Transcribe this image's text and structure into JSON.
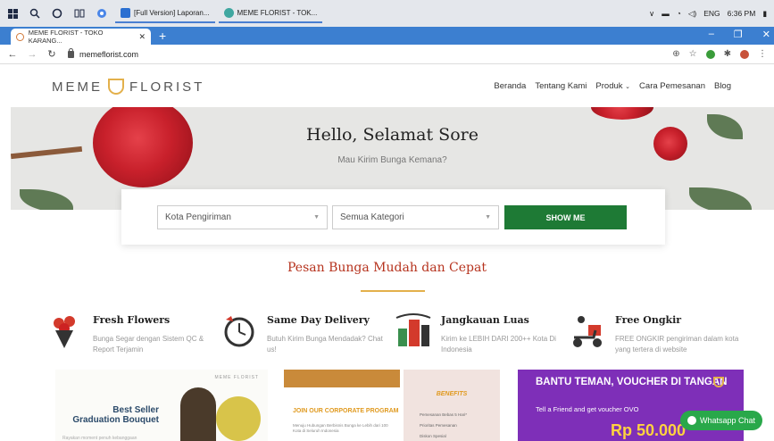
{
  "taskbar": {
    "apps": [
      {
        "label": "[Full Version] Laporan..."
      },
      {
        "label": "MEME FLORIST - TOK..."
      }
    ],
    "tray": {
      "language": "ENG",
      "time": "6:36 PM"
    }
  },
  "browser": {
    "tab_title": "MEME FLORIST - TOKO KARANG...",
    "tab_close": "✕",
    "new_tab": "+",
    "url": "memeflorist.com"
  },
  "site": {
    "logo_left": "MEME",
    "logo_right": "FLORIST",
    "nav": [
      "Beranda",
      "Tentang Kami",
      "Produk",
      "Cara Pemesanan",
      "Blog"
    ],
    "hero_title": "Hello, Selamat Sore",
    "hero_subtitle": "Mau Kirim Bunga Kemana?",
    "search": {
      "city_select": "Kota Pengiriman",
      "category_select": "Semua Kategori",
      "button": "SHOW ME"
    },
    "section_title": "Pesan Bunga Mudah dan Cepat",
    "features": [
      {
        "title": "Fresh Flowers",
        "desc": "Bunga Segar dengan Sistem QC & Report Terjamin"
      },
      {
        "title": "Same Day Delivery",
        "desc": "Butuh Kirim Bunga Mendadak? Chat us!"
      },
      {
        "title": "Jangkauan Luas",
        "desc": "Kirim ke LEBIH DARI 200++ Kota Di Indonesia"
      },
      {
        "title": "Free Ongkir",
        "desc": "FREE ONGKIR pengiriman dalam kota yang tertera di website"
      }
    ],
    "promos": {
      "card1": {
        "brand": "MEME FLORIST",
        "title": "Best Seller Graduation Bouquet",
        "sub": "Rayakan moment penuh kebanggaan"
      },
      "card2": {
        "title": "JOIN OUR CORPORATE PROGRAM",
        "text": "Menuju Hubungan Berbisnis Bunga ke Lebih dari 100 Kota di Seluruh Indonesia"
      },
      "card3": {
        "title": "BENEFITS",
        "items": [
          "Pemesanan Bebas 5 Hari*",
          "Prioritas Pemesanan",
          "Diskon Spesial"
        ]
      },
      "card4": {
        "title": "BANTU TEMAN, VOUCHER DI TANGAN",
        "sub": "Tell a Friend and get voucher OVO",
        "amount": "Rp 50.000"
      }
    },
    "whatsapp": "Whatsapp Chat"
  },
  "colors": {
    "brand_green": "#1e7a35",
    "heading_red": "#b6331e",
    "accent_gold": "#e3b04b",
    "promo_purple": "#7e2fb8",
    "whatsapp_green": "#29a84a"
  }
}
